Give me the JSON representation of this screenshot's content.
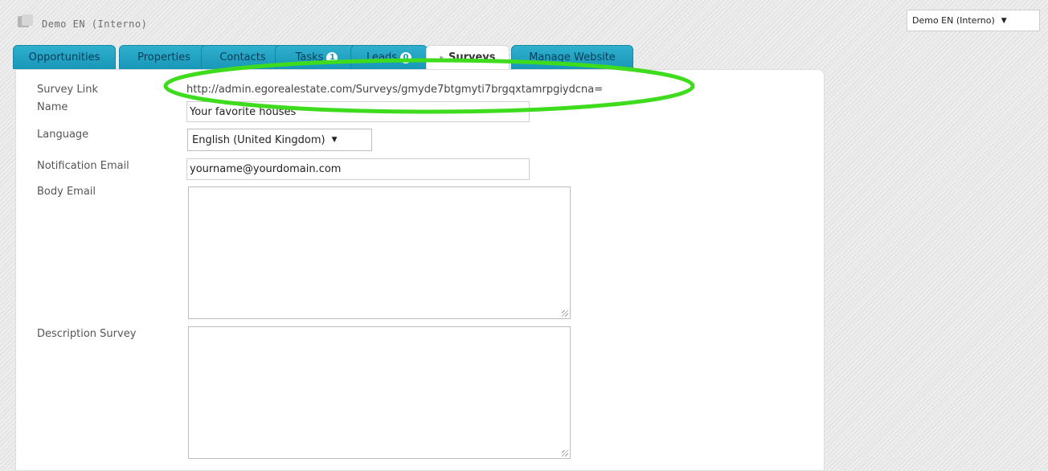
{
  "header": {
    "app_title": "Demo EN (Interno)",
    "company_select_value": "Demo EN (Interno)"
  },
  "tabs": [
    {
      "label": "Opportunities"
    },
    {
      "label": "Properties"
    },
    {
      "label": "Contacts"
    },
    {
      "label": "Tasks",
      "badge": "1"
    },
    {
      "label": "Leads",
      "badge": "0"
    },
    {
      "label": "Surveys",
      "active": true
    },
    {
      "label": "Manage Website"
    }
  ],
  "form": {
    "survey_link_label": "Survey Link",
    "survey_link_value": "http://admin.egorealestate.com/Surveys/gmyde7btgmyti7brgqxtamrpgiydcna=",
    "name_label": "Name",
    "name_value": "Your favorite houses",
    "language_label": "Language",
    "language_value": "English (United Kingdom)",
    "notification_email_label": "Notification Email",
    "notification_email_value": "yourname@yourdomain.com",
    "body_email_label": "Body Email",
    "body_email_value": "",
    "description_label": "Description Survey",
    "description_value": ""
  },
  "colors": {
    "tab_bg": "#1897b8",
    "highlight": "#3fdc1e"
  }
}
